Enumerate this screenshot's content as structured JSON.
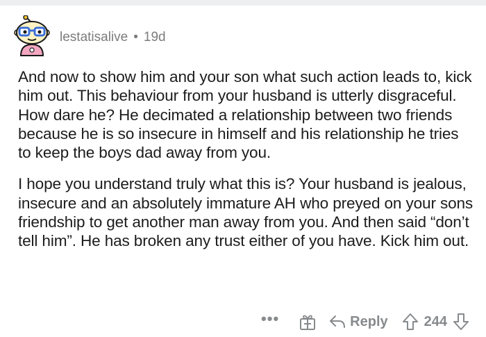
{
  "comment": {
    "author": "lestatisalive",
    "separator": "•",
    "age": "19d",
    "paragraphs": [
      "And now to show him and your son what such action leads to, kick him out. This behaviour from your husband is utterly disgraceful. How dare he? He decimated a relationship between two friends because he is so insecure in himself and his relationship he tries to keep the boys dad away from you.",
      "I hope you understand truly what this is? Your husband is jealous, insecure and an absolutely immature AH who preyed on your sons friendship to get another man away from you. And then said “don’t tell him”. He has broken any trust either of you have. Kick him out."
    ],
    "actions": {
      "more_label": "•••",
      "reply_label": "Reply",
      "score": "244"
    }
  },
  "icons": {
    "avatar": "snoo-avatar-icon",
    "award": "award-icon",
    "reply": "reply-arrow-icon",
    "upvote": "upvote-arrow-icon",
    "downvote": "downvote-arrow-icon"
  },
  "colors": {
    "meta_text": "#7c7c7c",
    "action_text": "#878a8c",
    "body_text": "#1c1c1c",
    "avatar_background": "#fff3c4",
    "avatar_glasses": "#3b6fd8",
    "avatar_shirt": "#f3a7c0"
  }
}
